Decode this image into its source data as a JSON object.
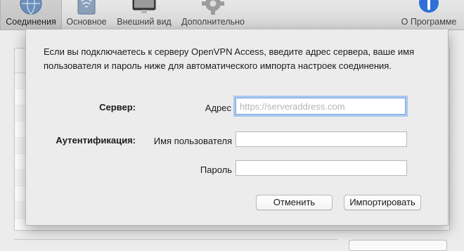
{
  "toolbar": {
    "tabs": [
      {
        "label": "Соединения",
        "icon": "network-globe-icon",
        "active": true
      },
      {
        "label": "Основное",
        "icon": "general-settings-icon",
        "active": false
      },
      {
        "label": "Внешний вид",
        "icon": "display-monitor-icon",
        "active": false
      },
      {
        "label": "Дополнительно",
        "icon": "gear-icon",
        "active": false
      }
    ],
    "about_label": "О Программе",
    "about_icon": "info-icon"
  },
  "dialog": {
    "intro_text": "Если вы подключаетесь к серверу OpenVPN Access, введите адрес сервера, ваше имя пользователя и пароль ниже для автоматического импорта настроек соединения.",
    "server_section_label": "Сервер:",
    "address_label": "Адрес",
    "address_value": "",
    "address_placeholder": "https://serveraddress.com",
    "auth_section_label": "Аутентификация:",
    "username_label": "Имя пользователя",
    "username_value": "",
    "password_label": "Пароль",
    "password_value": "",
    "cancel_label": "Отменить",
    "import_label": "Импортировать"
  },
  "colors": {
    "focus_ring": "#a9c8f0",
    "window_bg": "#ececec",
    "about_icon_blue": "#2f6fd6"
  }
}
